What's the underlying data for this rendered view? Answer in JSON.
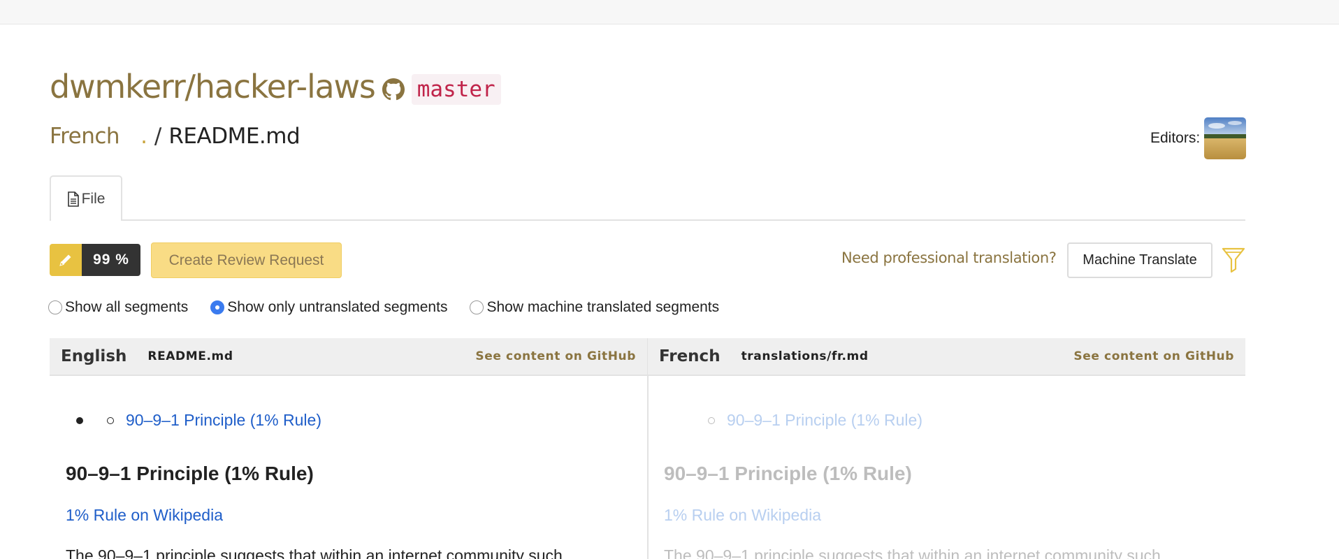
{
  "repo": {
    "name": "dwmkerr/hacker-laws",
    "branch": "master",
    "icon": "github-icon"
  },
  "path": {
    "language": "French",
    "dot": ".",
    "separator": "/",
    "file": "README.md"
  },
  "editors": {
    "label": "Editors:",
    "avatar": "editor-avatar"
  },
  "tabs": [
    {
      "label": "File",
      "icon": "file-icon"
    }
  ],
  "toolbar": {
    "progress": "99 %",
    "progress_value": 99,
    "review_button": "Create Review Request",
    "pro_link": "Need professional translation?",
    "machine_translate": "Machine Translate",
    "filter_icon": "filter-icon"
  },
  "segments": {
    "options": [
      "Show all segments",
      "Show only untranslated segments",
      "Show machine translated segments"
    ],
    "selected": "Show only untranslated segments"
  },
  "source": {
    "language": "English",
    "file": "README.md",
    "github_link": "See content on GitHub",
    "bullet_link": "90–9–1 Principle (1% Rule)",
    "heading": "90–9–1 Principle (1% Rule)",
    "wiki_link": "1% Rule on Wikipedia",
    "paragraph": "The 90–9–1 principle suggests that within an internet community such"
  },
  "target": {
    "language": "French",
    "file": "translations/fr.md",
    "github_link": "See content on GitHub",
    "bullet_link": "90–9–1 Principle (1% Rule)",
    "heading": "90–9–1 Principle (1% Rule)",
    "wiki_link": "1% Rule on Wikipedia",
    "paragraph": "The 90–9–1 principle suggests that within an internet community such"
  },
  "colors": {
    "accent": "#8a7440",
    "branch_text": "#c0244a",
    "progress_yellow": "#e8c241",
    "review_button": "#f9dc85",
    "link_blue": "#1f5ec9",
    "radio_selected": "#3a7bef"
  }
}
